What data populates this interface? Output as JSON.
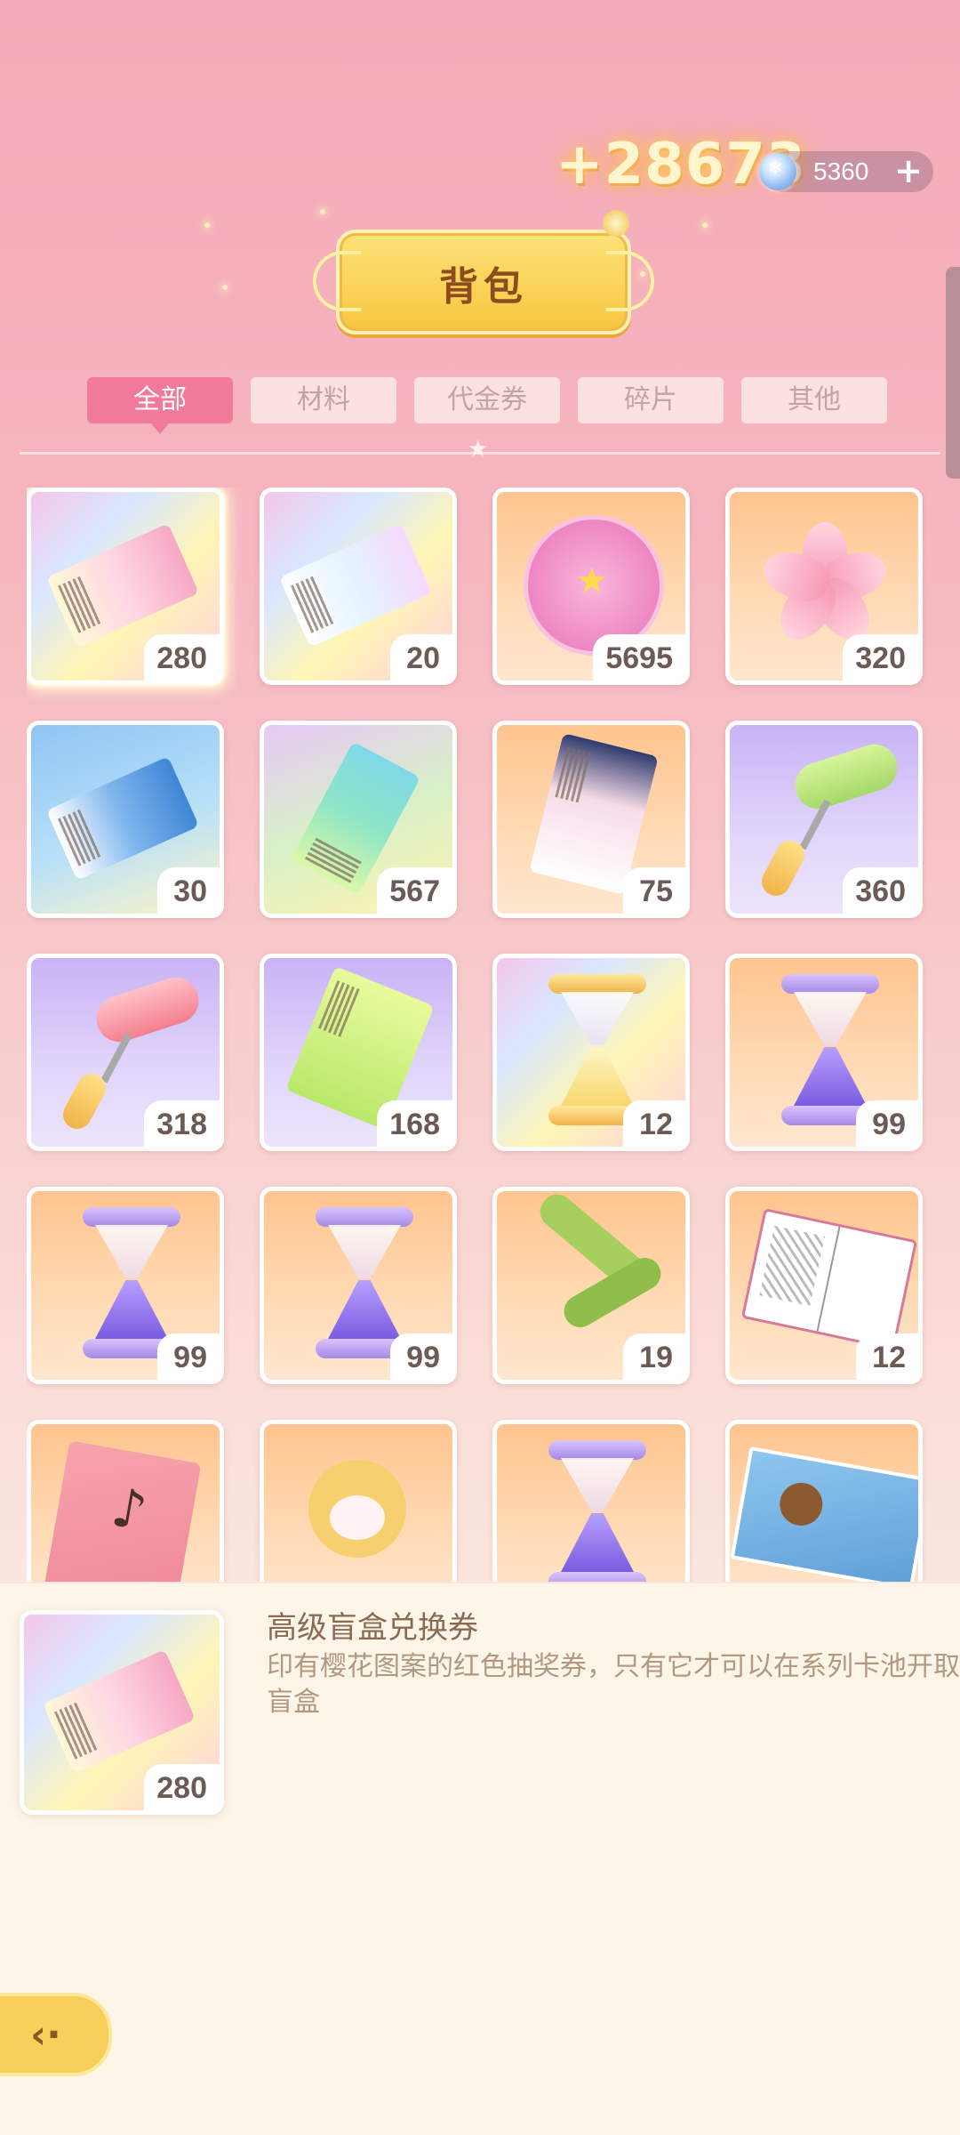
{
  "header": {
    "reward_popup": "+28673",
    "currency": {
      "icon": "snowflake-gem-icon",
      "value": "5360",
      "add_label": "+"
    },
    "title": "背包"
  },
  "tabs": [
    {
      "label": "全部",
      "active": true
    },
    {
      "label": "材料",
      "active": false
    },
    {
      "label": "代金券",
      "active": false
    },
    {
      "label": "碎片",
      "active": false
    },
    {
      "label": "其他",
      "active": false
    }
  ],
  "items": [
    {
      "icon": "premium-blind-box-ticket-icon",
      "quantity": "280"
    },
    {
      "icon": "sakura-avatar-ticket-icon",
      "quantity": "20"
    },
    {
      "icon": "pink-bag-coin-icon",
      "quantity": "5695"
    },
    {
      "icon": "sakura-flower-icon",
      "quantity": "320"
    },
    {
      "icon": "blue-ticket-icon",
      "quantity": "30"
    },
    {
      "icon": "video-ticket-icon",
      "quantity": "567"
    },
    {
      "icon": "bag-ticket-icon",
      "quantity": "75"
    },
    {
      "icon": "green-paint-roller-icon",
      "quantity": "360"
    },
    {
      "icon": "pink-paint-roller-icon",
      "quantity": "318"
    },
    {
      "icon": "green-bag-ticket-icon",
      "quantity": "168"
    },
    {
      "icon": "gold-hourglass-icon",
      "quantity": "12"
    },
    {
      "icon": "purple-hourglass-icon",
      "quantity": "99"
    },
    {
      "icon": "purple-hourglass-icon",
      "quantity": "99"
    },
    {
      "icon": "purple-hourglass-icon",
      "quantity": "99"
    },
    {
      "icon": "green-scarf-icon",
      "quantity": "19"
    },
    {
      "icon": "coloring-book-icon",
      "quantity": "12"
    },
    {
      "icon": "music-book-icon",
      "quantity": ""
    },
    {
      "icon": "bunny-pouch-icon",
      "quantity": ""
    },
    {
      "icon": "purple-hourglass-icon",
      "quantity": ""
    },
    {
      "icon": "toy-box-icon",
      "quantity": ""
    }
  ],
  "selected_item": {
    "name": "高级盲盒兑换券",
    "description": "印有樱花图案的红色抽奖券，只有它才可以在系列卡池开取盲盒",
    "quantity": "280",
    "icon": "premium-blind-box-ticket-icon"
  },
  "back_button": {
    "icon": "back-arrow-icon"
  },
  "colors": {
    "accent": "#f17a9a",
    "title_banner": "#f7c63f",
    "background_top": "#f4aab8",
    "panel": "#fcf5e8"
  }
}
